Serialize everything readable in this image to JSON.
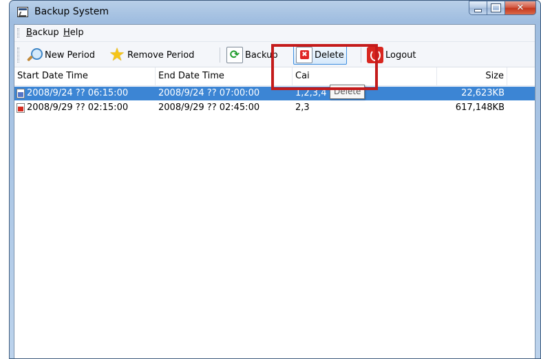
{
  "window": {
    "title": "Backup System",
    "controls": {
      "minimize": "minimize",
      "maximize": "maximize",
      "close": "close"
    }
  },
  "menu": {
    "items": [
      {
        "label": "Backup",
        "mnemonic": "B"
      },
      {
        "label": "Help",
        "mnemonic": "H"
      }
    ]
  },
  "toolbar": {
    "new_period": {
      "label": "New Period",
      "icon": "search-icon"
    },
    "remove_period": {
      "label": "Remove Period",
      "icon": "star-icon"
    },
    "backup": {
      "label": "Backup",
      "icon": "refresh-icon"
    },
    "delete": {
      "label": "Delete",
      "icon": "delete-icon"
    },
    "logout": {
      "label": "Logout",
      "icon": "logout-icon"
    }
  },
  "tooltip": {
    "text": "Delete"
  },
  "list": {
    "columns": {
      "start": "Start Date Time",
      "end": "End Date Time",
      "channel": "Cai",
      "size": "Size"
    },
    "rows": [
      {
        "start": "2008/9/24 ?? 06:15:00",
        "end": "2008/9/24 ?? 07:00:00",
        "channel": "1,2,3,4",
        "size": "22,623KB",
        "selected": true
      },
      {
        "start": "2008/9/29 ?? 02:15:00",
        "end": "2008/9/29 ?? 02:45:00",
        "channel": "2,3",
        "size": "617,148KB",
        "selected": false
      }
    ]
  },
  "colors": {
    "selection": "#3c85d4",
    "highlight_border": "#c41b1b",
    "hover_border": "#3d8ee0"
  }
}
